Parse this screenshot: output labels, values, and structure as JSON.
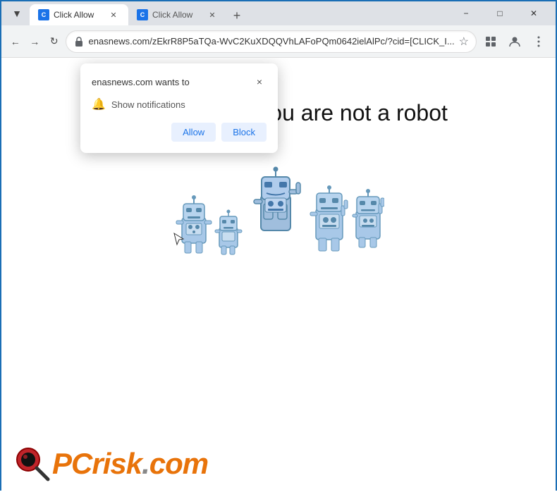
{
  "window": {
    "border_color": "#1a6eb5",
    "title": "Click Allow"
  },
  "titlebar": {
    "back_btn": "◀",
    "forward_btn": "▶",
    "reload_btn": "↻",
    "minimize_label": "−",
    "maximize_label": "□",
    "close_label": "✕"
  },
  "tabs": [
    {
      "id": "tab1",
      "title": "Click Allow",
      "active": true,
      "favicon": "C"
    },
    {
      "id": "tab2",
      "title": "Click Allow",
      "active": false,
      "favicon": "C"
    }
  ],
  "new_tab_btn": "+",
  "toolbar": {
    "back_label": "←",
    "forward_label": "→",
    "reload_label": "↻",
    "url": "enasnews.com/zEkrR8P5aTQa-WvC2KuXDQQVhLAFoPQm0642ielAlPc/?cid=[CLICK_I...",
    "bookmark_label": "☆",
    "profile_label": "👤",
    "menu_label": "⋮",
    "extensions_label": "⧉"
  },
  "notification_popup": {
    "title": "enasnews.com wants to",
    "close_btn": "×",
    "notification_item": "Show notifications",
    "allow_btn": "Allow",
    "block_btn": "Block"
  },
  "page": {
    "headline": "Click \"Allow\"   if you are not   a robot"
  },
  "footer": {
    "pcrisk_pc": "PC",
    "pcrisk_risk": "risk",
    "pcrisk_dot": ".",
    "pcrisk_com": "com"
  }
}
